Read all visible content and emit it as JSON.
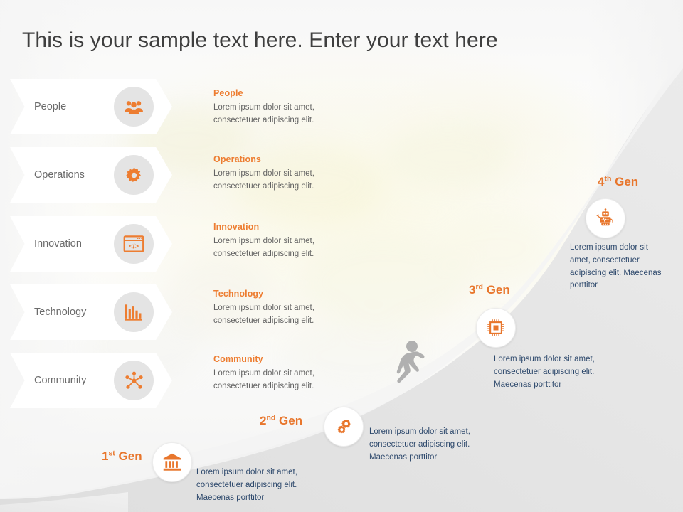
{
  "slide": {
    "title": "This is your sample text here. Enter your text here",
    "colors": {
      "accent_orange": "#ed7d31",
      "gen_orange": "#e8762c",
      "body_gray": "#636363",
      "gen_body_blue": "#2f4a6d",
      "banner_label_gray": "#6b6b6b",
      "title_gray": "#3f3f3f",
      "slope_gray": "#e3e3e3",
      "icon_circle_gray": "#e4e4e4"
    }
  },
  "banners": [
    {
      "label": "People",
      "icon": "people-group-icon"
    },
    {
      "label": "Operations",
      "icon": "gear-icon"
    },
    {
      "label": "Innovation",
      "icon": "code-window-icon"
    },
    {
      "label": "Technology",
      "icon": "bar-chart-icon"
    },
    {
      "label": "Community",
      "icon": "network-hub-icon"
    }
  ],
  "descriptions": [
    {
      "title": "People",
      "body": "Lorem  ipsum dolor sit amet, consectetuer  adipiscing elit."
    },
    {
      "title": "Operations",
      "body": "Lorem  ipsum dolor sit amet, consectetuer  adipiscing elit."
    },
    {
      "title": "Innovation",
      "body": "Lorem  ipsum dolor sit amet, consectetuer  adipiscing elit."
    },
    {
      "title": "Technology",
      "body": "Lorem  ipsum dolor sit amet, consectetuer  adipiscing elit."
    },
    {
      "title": "Community",
      "body": "Lorem  ipsum dolor sit amet, consectetuer  adipiscing elit."
    }
  ],
  "generations": [
    {
      "ordinal": "1",
      "suffix": "st",
      "word": "Gen",
      "icon": "bank-building-icon",
      "body": "Lorem ipsum  dolor sit amet, consectetuer  adipiscing elit. Maecenas porttitor"
    },
    {
      "ordinal": "2",
      "suffix": "nd",
      "word": "Gen",
      "icon": "gears-icon",
      "body": "Lorem ipsum  dolor sit amet, consectetuer  adipiscing elit. Maecenas porttitor"
    },
    {
      "ordinal": "3",
      "suffix": "rd",
      "word": "Gen",
      "icon": "microchip-icon",
      "body": "Lorem ipsum  dolor sit amet, consectetuer  adipiscing elit. Maecenas porttitor"
    },
    {
      "ordinal": "4",
      "suffix": "th",
      "word": "Gen",
      "icon": "robot-icon",
      "body": "Lorem ipsum  dolor sit amet, consectetuer  adipiscing elit. Maecenas porttitor"
    }
  ],
  "runner": {
    "icon": "running-person-icon"
  }
}
